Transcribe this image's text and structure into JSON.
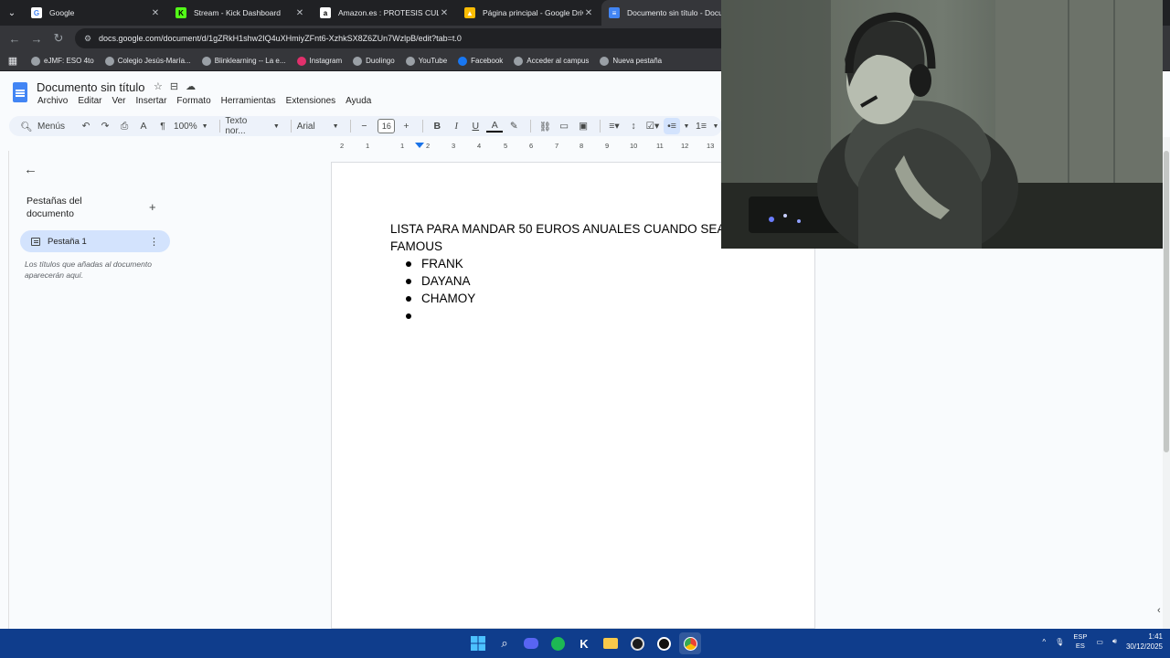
{
  "browser": {
    "tabs": [
      {
        "label": "Google",
        "icon": "google-icon",
        "color": "#ffffff",
        "letter": "G",
        "active": false
      },
      {
        "label": "Stream - Kick Dashboard",
        "icon": "kick-icon",
        "color": "#53fc18",
        "letter": "K",
        "active": false
      },
      {
        "label": "Amazon.es : PROTESIS CULO",
        "icon": "amazon-icon",
        "color": "#ffffff",
        "letter": "a",
        "active": false
      },
      {
        "label": "Página principal - Google Drive",
        "icon": "drive-icon",
        "color": "#fbbc04",
        "letter": "▲",
        "active": false
      },
      {
        "label": "Documento sin título - Docum",
        "icon": "docs-icon",
        "color": "#4285f4",
        "letter": "≡",
        "active": true
      }
    ],
    "url": "docs.google.com/document/d/1gZRkH1shw2IQ4uXHmiyZFnt6-XzhkSX8Z6ZUn7WzlpB/edit?tab=t.0",
    "bookmarks": [
      {
        "label": "eJMF: ESO 4to",
        "color": "#9aa0a6"
      },
      {
        "label": "Colegio Jesús-María...",
        "color": "#9aa0a6"
      },
      {
        "label": "Blinklearning -- La e...",
        "color": "#9aa0a6"
      },
      {
        "label": "Instagram",
        "color": "#e1306c"
      },
      {
        "label": "Duolingo",
        "color": "#9aa0a6"
      },
      {
        "label": "YouTube",
        "color": "#9aa0a6"
      },
      {
        "label": "Facebook",
        "color": "#1877f2"
      },
      {
        "label": "Acceder al campus",
        "color": "#9aa0a6"
      },
      {
        "label": "Nueva pestaña",
        "color": "#9aa0a6"
      }
    ]
  },
  "docs": {
    "title": "Documento sin título",
    "menu": [
      "Archivo",
      "Editar",
      "Ver",
      "Insertar",
      "Formato",
      "Herramientas",
      "Extensiones",
      "Ayuda"
    ],
    "toolbar": {
      "search_label": "Menús",
      "zoom": "100%",
      "style": "Texto nor...",
      "font": "Arial",
      "font_size": "16"
    },
    "sidebar": {
      "heading": "Pestañas del documento",
      "tab_label": "Pestaña 1",
      "hint": "Los títulos que añadas al documento aparecerán aquí."
    },
    "ruler": [
      "2",
      "1",
      "1",
      "2",
      "3",
      "4",
      "5",
      "6",
      "7",
      "8",
      "9",
      "10",
      "11",
      "12",
      "13",
      "14"
    ],
    "content": {
      "heading": "LISTA PARA MANDAR 50 EUROS ANUALES CUANDO SEA FAMOUS",
      "items": [
        "FRANK",
        "DAYANA",
        "CHAMOY",
        ""
      ]
    }
  },
  "taskbar": {
    "lang_top": "ESP",
    "lang_bottom": "ES",
    "time": "1:41",
    "date": "30/12/2025"
  }
}
